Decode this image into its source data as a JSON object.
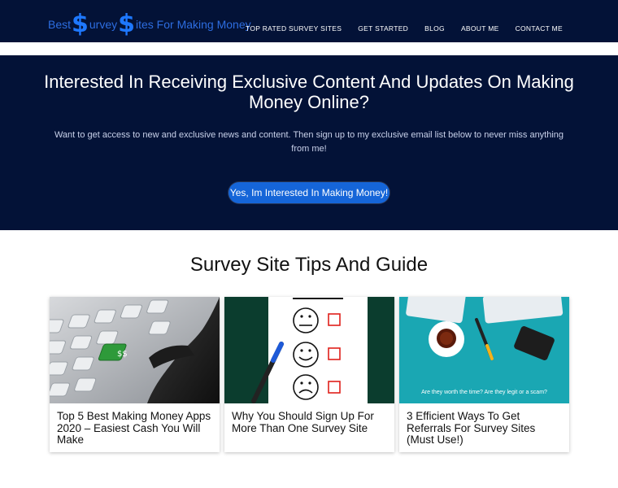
{
  "header": {
    "logo": {
      "part1": "Best",
      "dollar1": "$",
      "part2": "urvey",
      "dollar2": "$",
      "part3": "ites For Making Money"
    },
    "nav": [
      "TOP RATED SURVEY SITES",
      "GET STARTED",
      "BLOG",
      "ABOUT ME",
      "CONTACT ME"
    ]
  },
  "hero": {
    "title": "Interested In Receiving Exclusive Content And Updates On Making Money Online?",
    "text": "Want to get access to new and exclusive news and content. Then sign up to my exclusive email list below to never miss anything from me!",
    "button": "Yes, Im Interested In Making Money!"
  },
  "section": {
    "title": "Survey Site Tips And Guide"
  },
  "cards": [
    {
      "title": "Top 5 Best Making Money Apps 2020 – Easiest Cash You Will Make"
    },
    {
      "title": "Why You Should Sign Up For More Than One Survey Site"
    },
    {
      "title": "3 Efficient Ways To Get Referrals For Survey Sites (Must Use!)",
      "image_text": "Are they worth the time? Are they legit or a scam?"
    }
  ],
  "colors": {
    "navy": "#031237",
    "button": "#1565d8",
    "logo_blue": "#2d6de0"
  }
}
